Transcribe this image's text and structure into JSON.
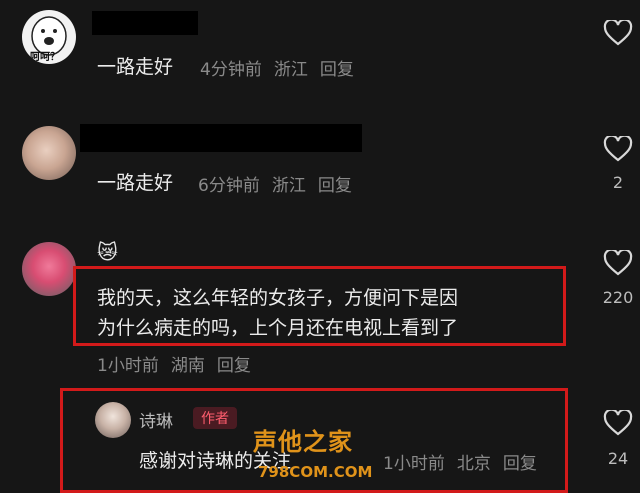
{
  "comments": [
    {
      "avatar": "cartoon-face-avatar",
      "avatar_text": "呵呵？",
      "text": "一路走好",
      "time": "4分钟前",
      "location": "浙江",
      "reply": "回复",
      "likes": ""
    },
    {
      "avatar": "hand-photo-avatar",
      "text": "一路走好",
      "time": "6分钟前",
      "location": "浙江",
      "reply": "回复",
      "likes": "2"
    },
    {
      "avatar": "pink-toy-avatar",
      "emoji": "😿",
      "text_line1": "我的天，这么年轻的女孩子，方便问下是因",
      "text_line2": "为什么病走的吗，上个月还在电视上看到了",
      "time": "1小时前",
      "location": "湖南",
      "reply": "回复",
      "likes": "220"
    },
    {
      "avatar": "girl-photo-avatar",
      "name": "诗琳",
      "badge": "作者",
      "text": "感谢对诗琳的关注",
      "time": "1小时前",
      "location": "北京",
      "reply": "回复",
      "likes": "24"
    }
  ],
  "watermark": {
    "cn": "声他之家",
    "en": "798COM.COM"
  },
  "icons": {
    "like": "heart-outline-icon"
  },
  "colors": {
    "background": "#161616",
    "highlight_box": "#d21a1a",
    "badge_text": "#ff5d6e",
    "watermark": "#e0931a"
  }
}
